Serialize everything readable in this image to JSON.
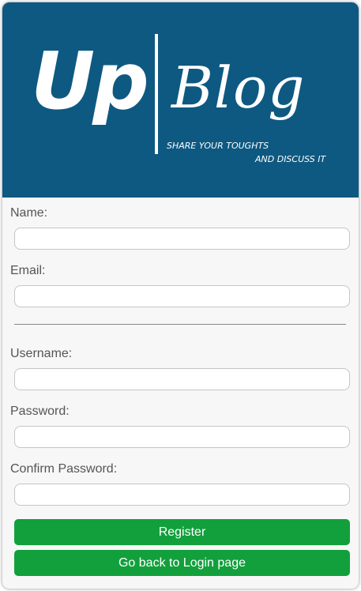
{
  "colors": {
    "banner_bg": "#0e5981",
    "card_bg": "#f7f7f7",
    "button_bg": "#12a03c",
    "button_text": "#ffffff",
    "label_text": "#555555"
  },
  "logo": {
    "up": "Up",
    "blog": "Blog",
    "tagline_line1": "SHARE YOUR TOUGHTS",
    "tagline_line2": "AND DISCUSS IT"
  },
  "form": {
    "name": {
      "label": "Name:",
      "value": ""
    },
    "email": {
      "label": "Email:",
      "value": ""
    },
    "username": {
      "label": "Username:",
      "value": ""
    },
    "password": {
      "label": "Password:",
      "value": ""
    },
    "confirm_password": {
      "label": "Confirm Password:",
      "value": ""
    }
  },
  "buttons": {
    "register": "Register",
    "back_to_login": "Go back to Login page"
  }
}
